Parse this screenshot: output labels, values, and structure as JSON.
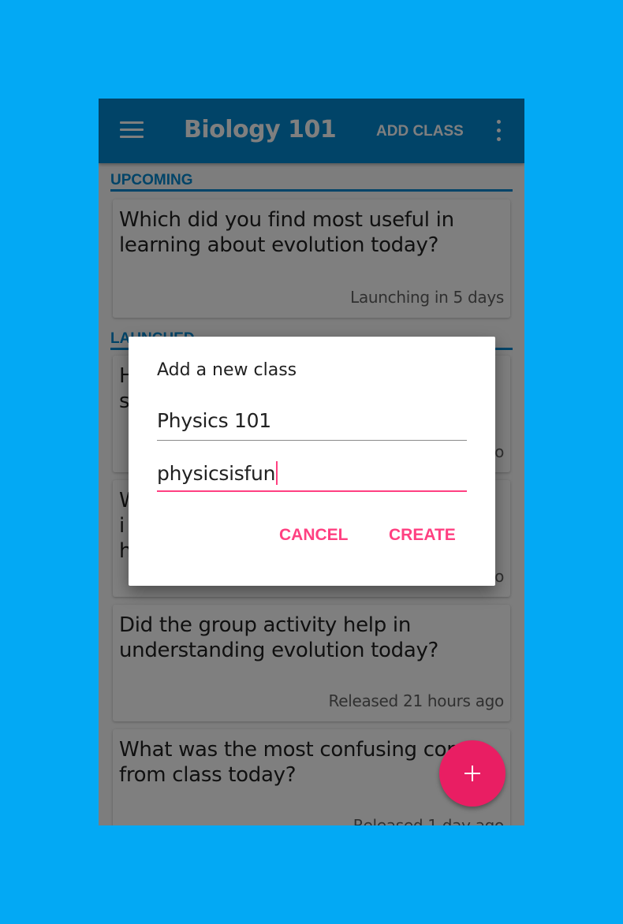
{
  "appbar": {
    "menu_icon": "hamburger-menu-icon",
    "title": "Biology 101",
    "add_class_label": "ADD CLASS",
    "overflow_icon": "more-vert-icon",
    "color": "#0288D1"
  },
  "sections": {
    "upcoming_label": "UPCOMING",
    "launched_label": "LAUNCHED"
  },
  "cards": [
    {
      "question": "Which did you find most useful in learning about evolution today?",
      "meta": "Launching in 5 days"
    },
    {
      "question": "H\ns",
      "meta": "o"
    },
    {
      "question": "W d\ni\nh",
      "meta": "o"
    },
    {
      "question": "Did the group activity help in understanding evolution today?",
      "meta": "Released 21 hours ago"
    },
    {
      "question": "What was the most confusing conc from class today?",
      "meta": "Released 1 day ago"
    }
  ],
  "fab": {
    "icon": "plus-icon",
    "color": "#E91E63"
  },
  "dialog": {
    "title": "Add a new class",
    "class_name_value": "Physics 101",
    "class_code_value": "physicsisfun",
    "cancel_label": "CANCEL",
    "create_label": "CREATE",
    "accent_color": "#FF4081"
  }
}
